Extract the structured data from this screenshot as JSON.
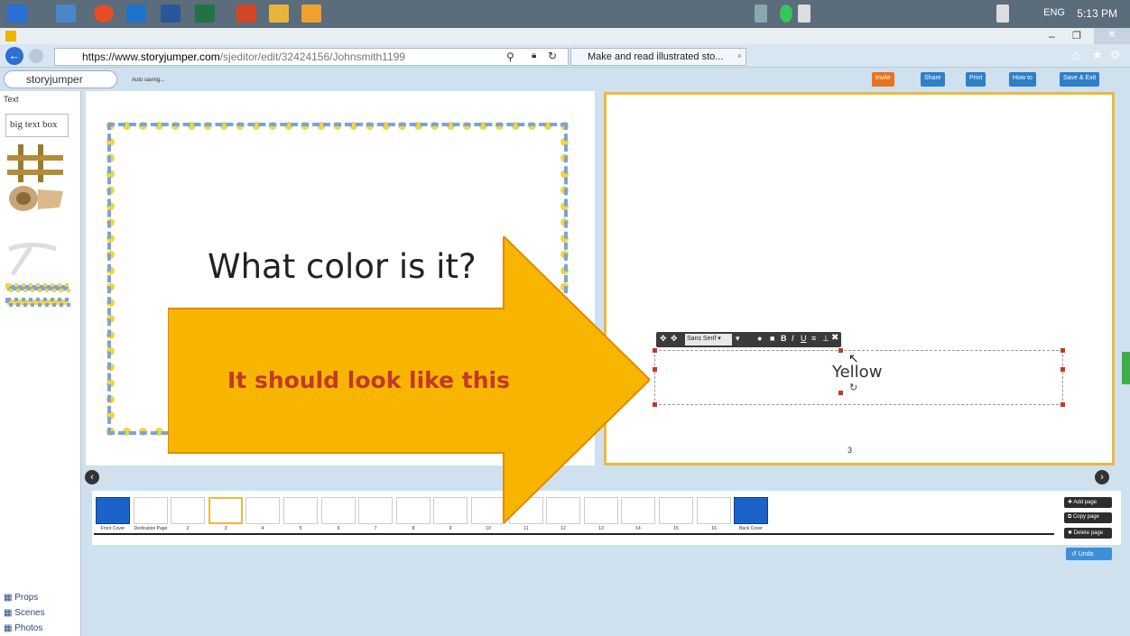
{
  "taskbar": {
    "clock": "5:13 PM",
    "language": "ENG",
    "icons": [
      "windows-logo-icon",
      "task-view-icon",
      "chrome-icon",
      "ie-icon",
      "word-icon",
      "excel-icon",
      "powerpoint-icon",
      "files-icon",
      "media-icon"
    ]
  },
  "browser": {
    "url_prefix": "https://www.",
    "url_domain": "storyjumper.com",
    "url_path": "/sjeditor/edit/32424156/Johnsmith1199",
    "tab_title": "Make and read illustrated sto...",
    "search_icon": "search-icon"
  },
  "app": {
    "logo_text": "storyjumper",
    "autosave": "Auto saving...",
    "header_buttons": [
      {
        "label": "Invite",
        "color": "#e8731e"
      },
      {
        "label": "Share",
        "color": "#2f7fc7"
      },
      {
        "label": "Print",
        "color": "#2f7fc7"
      },
      {
        "label": "How to",
        "color": "#2f7fc7"
      },
      {
        "label": "Save & Exit",
        "color": "#2f7fc7"
      }
    ]
  },
  "sidebar": {
    "text_label": "Text",
    "big_text_box": "big text box",
    "links": [
      "Props",
      "Scenes",
      "Photos"
    ]
  },
  "canvas": {
    "left_page_text": "What color is it?",
    "right_page_text": "Yellow",
    "font_select": "Sans Serif",
    "page_number": "3"
  },
  "filmstrip": {
    "thumb_labels": [
      "Front Cover",
      "Dedication Page",
      "2",
      "3",
      "4",
      "5",
      "6",
      "7",
      "8",
      "9",
      "10",
      "11",
      "12",
      "13",
      "14",
      "15",
      "16",
      "Back Cover"
    ],
    "add_page": "Add page",
    "copy_page": "Copy page",
    "delete_page": "Delete page",
    "undo": "Undo"
  },
  "overlay": {
    "arrow_text": "It should look like this",
    "arrow_color": "#f7b500"
  }
}
